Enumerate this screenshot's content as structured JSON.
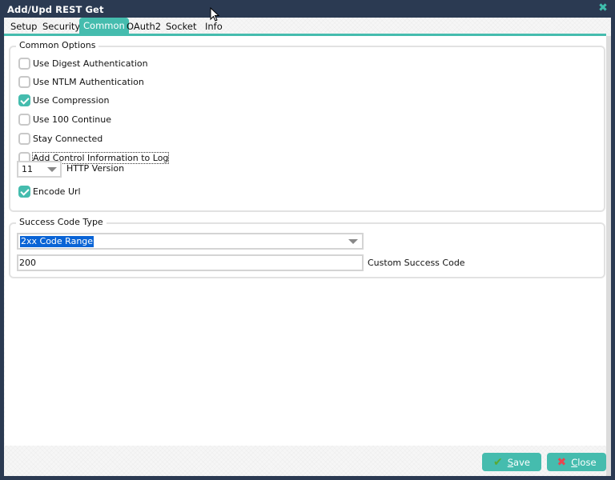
{
  "window": {
    "title": "Add/Upd REST Get",
    "close_icon": "close-x-icon"
  },
  "tabs": [
    {
      "label": "Setup",
      "active": false
    },
    {
      "label": "Security",
      "active": false
    },
    {
      "label": "Common",
      "active": true
    },
    {
      "label": "OAuth2",
      "active": false
    },
    {
      "label": "Socket",
      "active": false
    },
    {
      "label": "Info",
      "active": false
    }
  ],
  "common_options": {
    "legend": "Common Options",
    "checkboxes": [
      {
        "label": "Use Digest Authentication",
        "checked": false
      },
      {
        "label": "Use NTLM Authentication",
        "checked": false
      },
      {
        "label": "Use Compression",
        "checked": true
      },
      {
        "label": "Use 100 Continue",
        "checked": false
      },
      {
        "label": "Stay Connected",
        "checked": false
      },
      {
        "label": "Add Control Information to Log",
        "checked": false,
        "focused": true
      }
    ],
    "http_version": {
      "value": "11",
      "label": "HTTP Version"
    },
    "encode_url": {
      "label": "Encode Url",
      "checked": true
    }
  },
  "success_code": {
    "legend": "Success Code Type",
    "type_value": "2xx Code Range",
    "custom_code_value": "200",
    "custom_code_label": "Custom Success Code"
  },
  "footer": {
    "save_label_ul": "S",
    "save_label_rest": "ave",
    "close_label_ul": "C",
    "close_label_rest": "lose"
  },
  "colors": {
    "accent": "#45bcae",
    "titlebar": "#2b3a52",
    "selection": "#0a64d6"
  }
}
